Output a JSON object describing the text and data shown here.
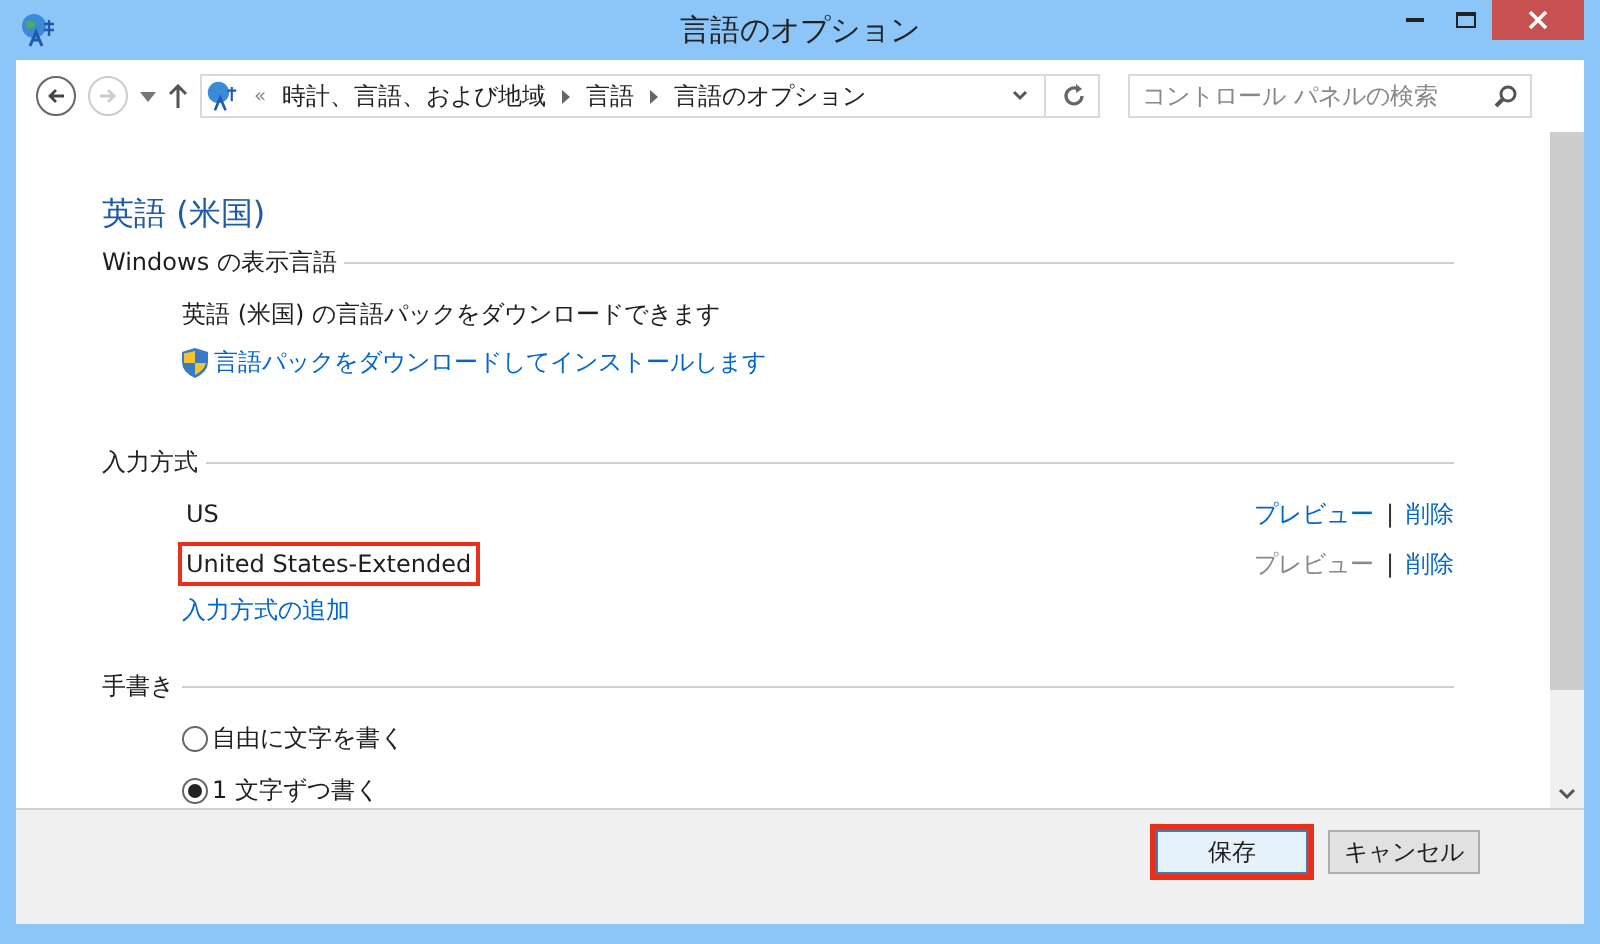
{
  "window": {
    "title": "言語のオプション"
  },
  "nav": {
    "back_disabled": false,
    "forward_disabled": true,
    "breadcrumb": [
      "«",
      "時計、言語、および地域",
      "言語",
      "言語のオプション"
    ],
    "search": {
      "placeholder": "コントロール パネルの検索"
    }
  },
  "heading": "英語 (米国)",
  "display_language": {
    "title": "Windows の表示言語",
    "message": "英語 (米国) の言語パックをダウンロードできます",
    "link": "言語パックをダウンロードしてインストールします"
  },
  "input_methods": {
    "title": "入力方式",
    "items": [
      {
        "name": "US",
        "highlighted": false,
        "preview": "プレビュー",
        "preview_disabled": false,
        "separator": "|",
        "remove": "削除"
      },
      {
        "name": "United States-Extended",
        "highlighted": true,
        "preview": "プレビュー",
        "preview_disabled": true,
        "separator": "|",
        "remove": "削除"
      }
    ],
    "add_link": "入力方式の追加"
  },
  "handwriting": {
    "title": "手書き",
    "options": [
      {
        "label": "自由に文字を書く",
        "selected": false
      },
      {
        "label": "1 文字ずつ書く",
        "selected": true
      }
    ]
  },
  "buttons": [
    {
      "label": "保存",
      "highlighted": true
    },
    {
      "label": "キャンセル",
      "highlighted": false
    }
  ]
}
